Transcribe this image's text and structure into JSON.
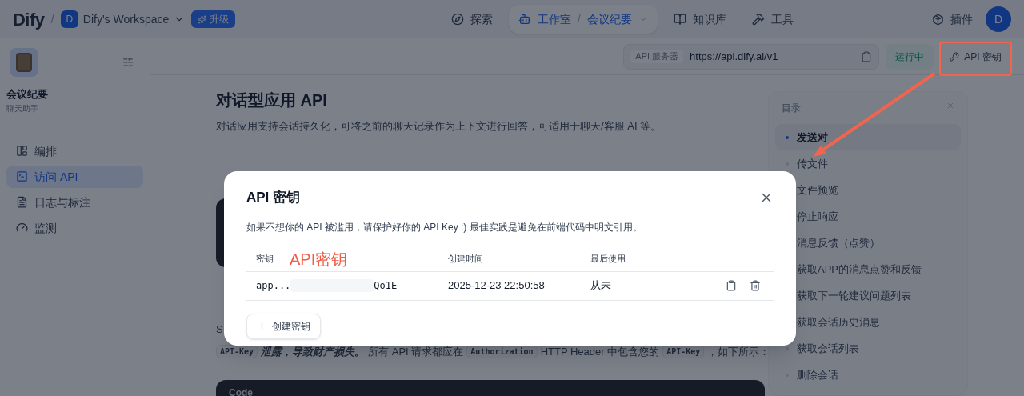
{
  "header": {
    "logo": "Dify",
    "separator": "/",
    "workspace": {
      "initial": "D",
      "name": "Dify's Workspace"
    },
    "upgrade": "升级",
    "nav": [
      {
        "kind": "explore",
        "label": "探索",
        "selected": false
      },
      {
        "kind": "studio",
        "label": "工作室",
        "selected": true,
        "separator": "/",
        "current_app": "会议纪要"
      },
      {
        "kind": "knowledge",
        "label": "知识库",
        "selected": false
      },
      {
        "kind": "tools",
        "label": "工具",
        "selected": false
      }
    ],
    "plugins": "插件",
    "avatar": "D"
  },
  "sidebar": {
    "app": {
      "name": "会议纪要",
      "type": "聊天助手"
    },
    "items": [
      {
        "kind": "orchestrate",
        "label": "编排",
        "selected": false
      },
      {
        "kind": "api",
        "label": "访问 API",
        "selected": true
      },
      {
        "kind": "logs",
        "label": "日志与标注",
        "selected": false
      },
      {
        "kind": "monitor",
        "label": "监测",
        "selected": false
      }
    ]
  },
  "toolbar": {
    "server_label": "API 服务器",
    "server_url": "https://api.dify.ai/v1",
    "status": "运行中",
    "api_key_button": "API 密钥"
  },
  "doc": {
    "title": "对话型应用 API",
    "description": "对话应用支持会话持久化，可将之前的聊天记录作为上下文进行回答，可适用于聊天/客服 AI 等。",
    "auth_text": "S",
    "auth_line": [
      {
        "kind": "code",
        "text": "API-Key"
      },
      {
        "kind": "bold",
        "text": "泄露，导致财产损失。"
      },
      {
        "kind": "plain",
        "text": "所有 API 请求都应在"
      },
      {
        "kind": "code",
        "text": "Authorization"
      },
      {
        "kind": "plain",
        "text": "HTTP Header 中包含您的"
      },
      {
        "kind": "code",
        "text": "API-Key"
      },
      {
        "kind": "plain",
        "text": "，如下所示："
      }
    ],
    "code_title": "Code"
  },
  "toc": {
    "title": "目录",
    "items": [
      {
        "label": "发送对",
        "selected": true
      },
      {
        "label": "传文件",
        "selected": false
      },
      {
        "label": "文件预览",
        "selected": false
      },
      {
        "label": "停止响应",
        "selected": false
      },
      {
        "label": "消息反馈（点赞）",
        "selected": false
      },
      {
        "label": "获取APP的消息点赞和反馈",
        "selected": false
      },
      {
        "label": "获取下一轮建议问题列表",
        "selected": false
      },
      {
        "label": "获取会话历史消息",
        "selected": false
      },
      {
        "label": "获取会话列表",
        "selected": false
      },
      {
        "label": "删除会话",
        "selected": false
      }
    ]
  },
  "modal": {
    "title": "API 密钥",
    "note": "如果不想你的 API 被滥用，请保护好你的 API Key :) 最佳实践是避免在前端代码中明文引用。",
    "columns": [
      "密钥",
      "创建时间",
      "最后使用"
    ],
    "rows": [
      {
        "key_start": "app...",
        "key_end": "Qo1E",
        "created": "2025-12-23 22:50:58",
        "last_used": "从未"
      }
    ],
    "create_button": "创建密钥"
  },
  "annotation": {
    "label": "API密钥"
  }
}
